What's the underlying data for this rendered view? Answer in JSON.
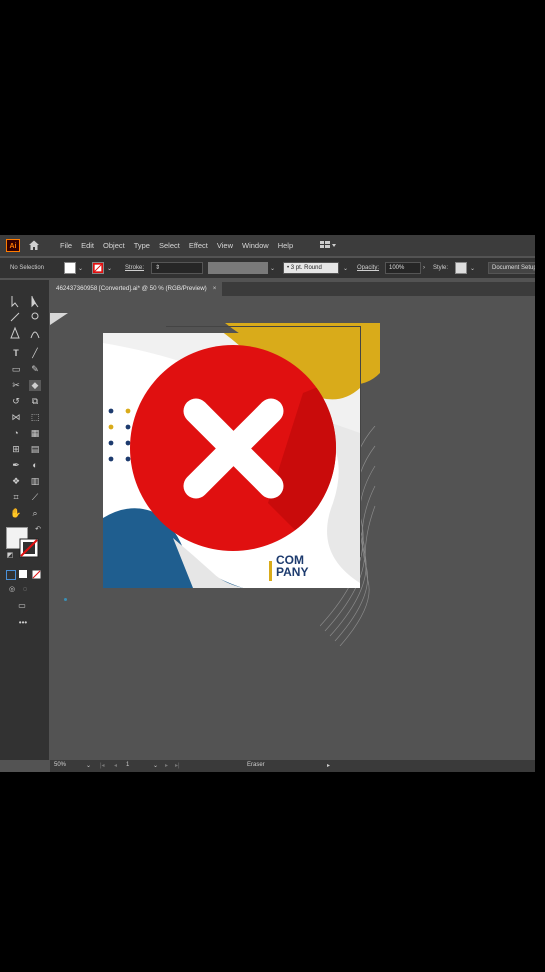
{
  "app": {
    "logo_text": "Ai",
    "menu": [
      "File",
      "Edit",
      "Object",
      "Type",
      "Select",
      "Effect",
      "View",
      "Window",
      "Help"
    ]
  },
  "control_bar": {
    "selection_label": "No Selection",
    "stroke_label": "Stroke:",
    "brush_value": "3 pt. Round",
    "opacity_label": "Opacity:",
    "opacity_value": "100%",
    "style_label": "Style:",
    "document_setup": "Document Setup"
  },
  "document_tab": {
    "title": "462437360958 [Converted].ai* @ 50 % (RGB/Preview)",
    "close": "×"
  },
  "artwork": {
    "brand_line1": "COM",
    "brand_line2": "PANY",
    "colors": {
      "yellow": "#d9ab1a",
      "blue": "#1f5e8f",
      "navy": "#1d3b6e",
      "red": "#e01010",
      "dark_red": "#c40a0a"
    }
  },
  "status_bar": {
    "zoom": "50%",
    "artboard_number": "1",
    "tool_name": "Eraser"
  }
}
